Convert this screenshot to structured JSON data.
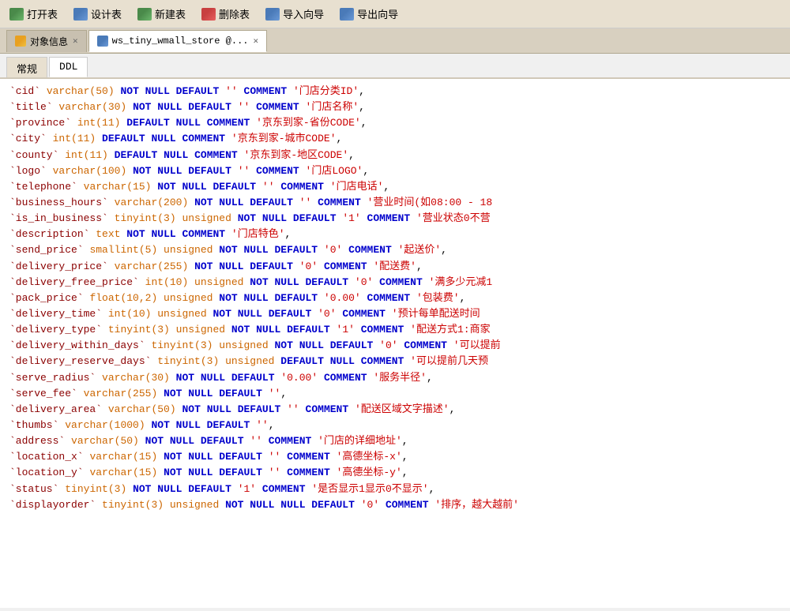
{
  "toolbar": {
    "buttons": [
      {
        "label": "打开表",
        "icon": "open-icon",
        "iconClass": "tb-icon-open"
      },
      {
        "label": "设计表",
        "icon": "design-icon",
        "iconClass": "tb-icon-design"
      },
      {
        "label": "新建表",
        "icon": "new-icon",
        "iconClass": "tb-icon-new"
      },
      {
        "label": "删除表",
        "icon": "delete-icon",
        "iconClass": "tb-icon-delete"
      },
      {
        "label": "导入向导",
        "icon": "import-icon",
        "iconClass": "tb-icon-import"
      },
      {
        "label": "导出向导",
        "icon": "export-icon",
        "iconClass": "tb-icon-export"
      }
    ]
  },
  "tabs": [
    {
      "label": "对象信息",
      "iconClass": "tab-icon-obj",
      "closable": true,
      "active": false
    },
    {
      "label": "ws_tiny_wmall_store @...",
      "iconClass": "tab-icon-table",
      "closable": true,
      "active": true
    }
  ],
  "subtabs": [
    {
      "label": "常规",
      "active": false
    },
    {
      "label": "DDL",
      "active": true
    }
  ],
  "sql": {
    "lines": [
      "`cid` varchar(50) NOT NULL DEFAULT '' COMMENT '门店分类ID',",
      "`title` varchar(30) NOT NULL DEFAULT '' COMMENT '门店名称',",
      "`province` int(11) DEFAULT NULL COMMENT '京东到家-省份CODE',",
      "`city` int(11) DEFAULT NULL COMMENT '京东到家-城市CODE',",
      "`county` int(11) DEFAULT NULL COMMENT '京东到家-地区CODE',",
      "`logo` varchar(100) NOT NULL DEFAULT '' COMMENT '门店LOGO',",
      "`telephone` varchar(15) NOT NULL DEFAULT '' COMMENT '门店电话',",
      "`business_hours` varchar(200) NOT NULL DEFAULT '' COMMENT '营业时间(如08:00 - 18",
      "`is_in_business` tinyint(3) unsigned NOT NULL DEFAULT '1' COMMENT '营业状态0不营",
      "`description` text NOT NULL COMMENT '门店特色',",
      "`send_price` smallint(5) unsigned NOT NULL DEFAULT '0' COMMENT '起送价',",
      "`delivery_price` varchar(255) NOT NULL DEFAULT '0' COMMENT '配送费',",
      "`delivery_free_price` int(10) unsigned NOT NULL DEFAULT '0' COMMENT '满多少元减1",
      "`pack_price` float(10,2) unsigned NOT NULL DEFAULT '0.00' COMMENT '包装费',",
      "`delivery_time` int(10) unsigned NOT NULL DEFAULT '0' COMMENT '预计每单配送时间",
      "`delivery_type` tinyint(3) unsigned NOT NULL DEFAULT '1' COMMENT '配送方式1:商家",
      "`delivery_within_days` tinyint(3) unsigned NOT NULL DEFAULT '0' COMMENT '可以提前",
      "`delivery_reserve_days` tinyint(3) unsigned DEFAULT NULL COMMENT '可以提前几天预",
      "`serve_radius` varchar(30) NOT NULL DEFAULT '0.00' COMMENT '服务半径',",
      "`serve_fee` varchar(255) NOT NULL DEFAULT '',",
      "`delivery_area` varchar(50) NOT NULL DEFAULT '' COMMENT '配送区域文字描述',",
      "`thumbs` varchar(1000) NOT NULL DEFAULT '',",
      "`address` varchar(50) NOT NULL DEFAULT '' COMMENT '门店的详细地址',",
      "`location_x` varchar(15) NOT NULL DEFAULT '' COMMENT '高德坐标-x',",
      "`location_y` varchar(15) NOT NULL DEFAULT '' COMMENT '高德坐标-y',",
      "`status` tinyint(3) NOT NULL DEFAULT '1' COMMENT '是否显示1显示0不显示',",
      "`displayorder` tinyint(3) unsigned NOT NULL NULL DEFAULT '0' COMMENT '排序，越大越前'"
    ]
  }
}
